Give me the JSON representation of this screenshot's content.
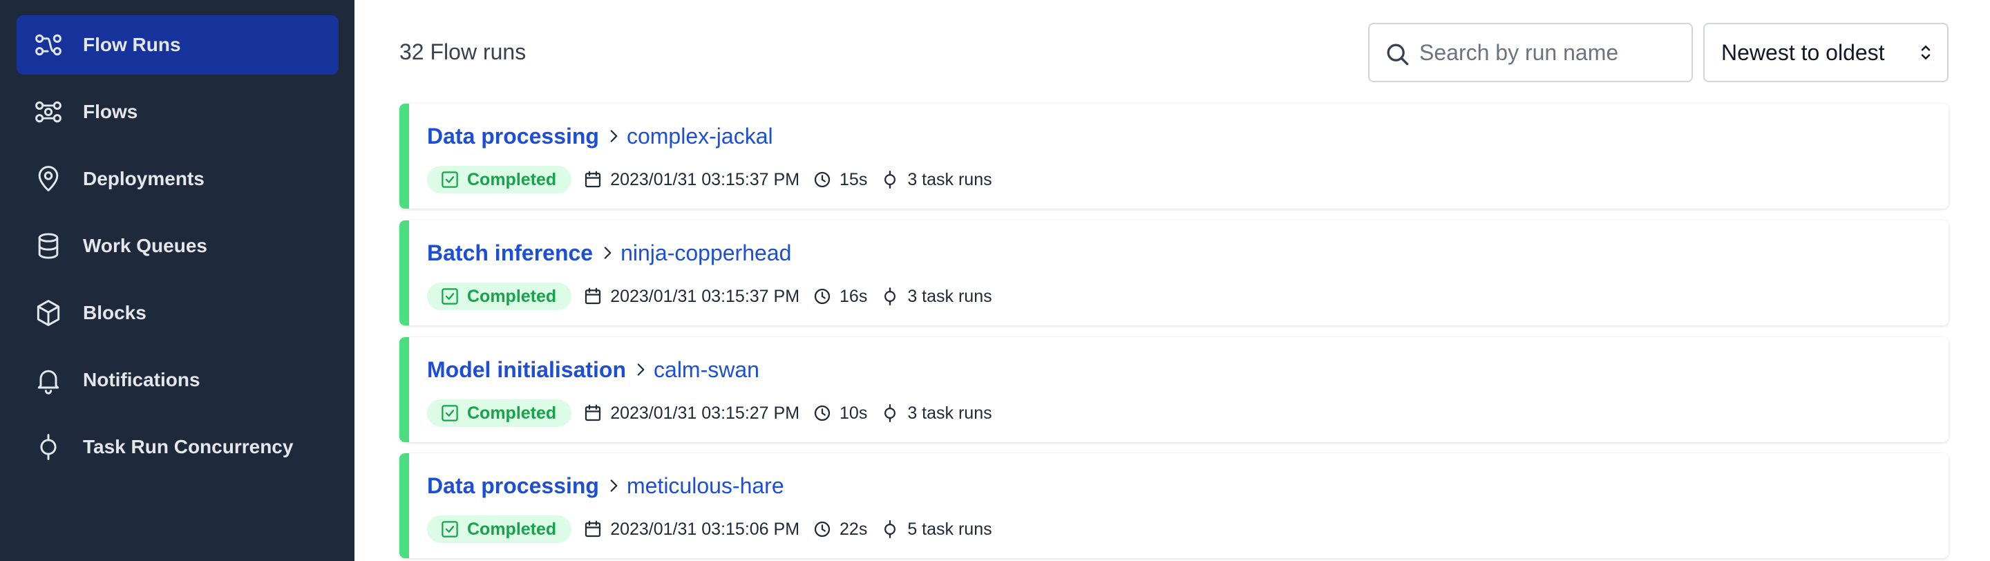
{
  "sidebar": {
    "items": [
      {
        "label": "Flow Runs",
        "icon": "flow-runs-icon",
        "active": true
      },
      {
        "label": "Flows",
        "icon": "flows-icon",
        "active": false
      },
      {
        "label": "Deployments",
        "icon": "location-pin-icon",
        "active": false
      },
      {
        "label": "Work Queues",
        "icon": "database-icon",
        "active": false
      },
      {
        "label": "Blocks",
        "icon": "cube-icon",
        "active": false
      },
      {
        "label": "Notifications",
        "icon": "bell-icon",
        "active": false
      },
      {
        "label": "Task Run Concurrency",
        "icon": "task-run-icon",
        "active": false
      }
    ]
  },
  "main": {
    "count_label": "32 Flow runs",
    "search": {
      "placeholder": "Search by run name",
      "value": ""
    },
    "sort": {
      "selected": "Newest to oldest"
    },
    "runs": [
      {
        "flow": "Data processing",
        "run": "complex-jackal",
        "state": "Completed",
        "start": "2023/01/31 03:15:37 PM",
        "duration": "15s",
        "task_runs": "3 task runs"
      },
      {
        "flow": "Batch inference",
        "run": "ninja-copperhead",
        "state": "Completed",
        "start": "2023/01/31 03:15:37 PM",
        "duration": "16s",
        "task_runs": "3 task runs"
      },
      {
        "flow": "Model initialisation",
        "run": "calm-swan",
        "state": "Completed",
        "start": "2023/01/31 03:15:27 PM",
        "duration": "10s",
        "task_runs": "3 task runs"
      },
      {
        "flow": "Data processing",
        "run": "meticulous-hare",
        "state": "Completed",
        "start": "2023/01/31 03:15:06 PM",
        "duration": "22s",
        "task_runs": "5 task runs"
      }
    ]
  },
  "colors": {
    "sidebar_bg": "#1e293b",
    "active_nav": "#15339a",
    "link": "#1d4ed8",
    "completed": "#4ade80",
    "completed_text": "#16a34a"
  }
}
